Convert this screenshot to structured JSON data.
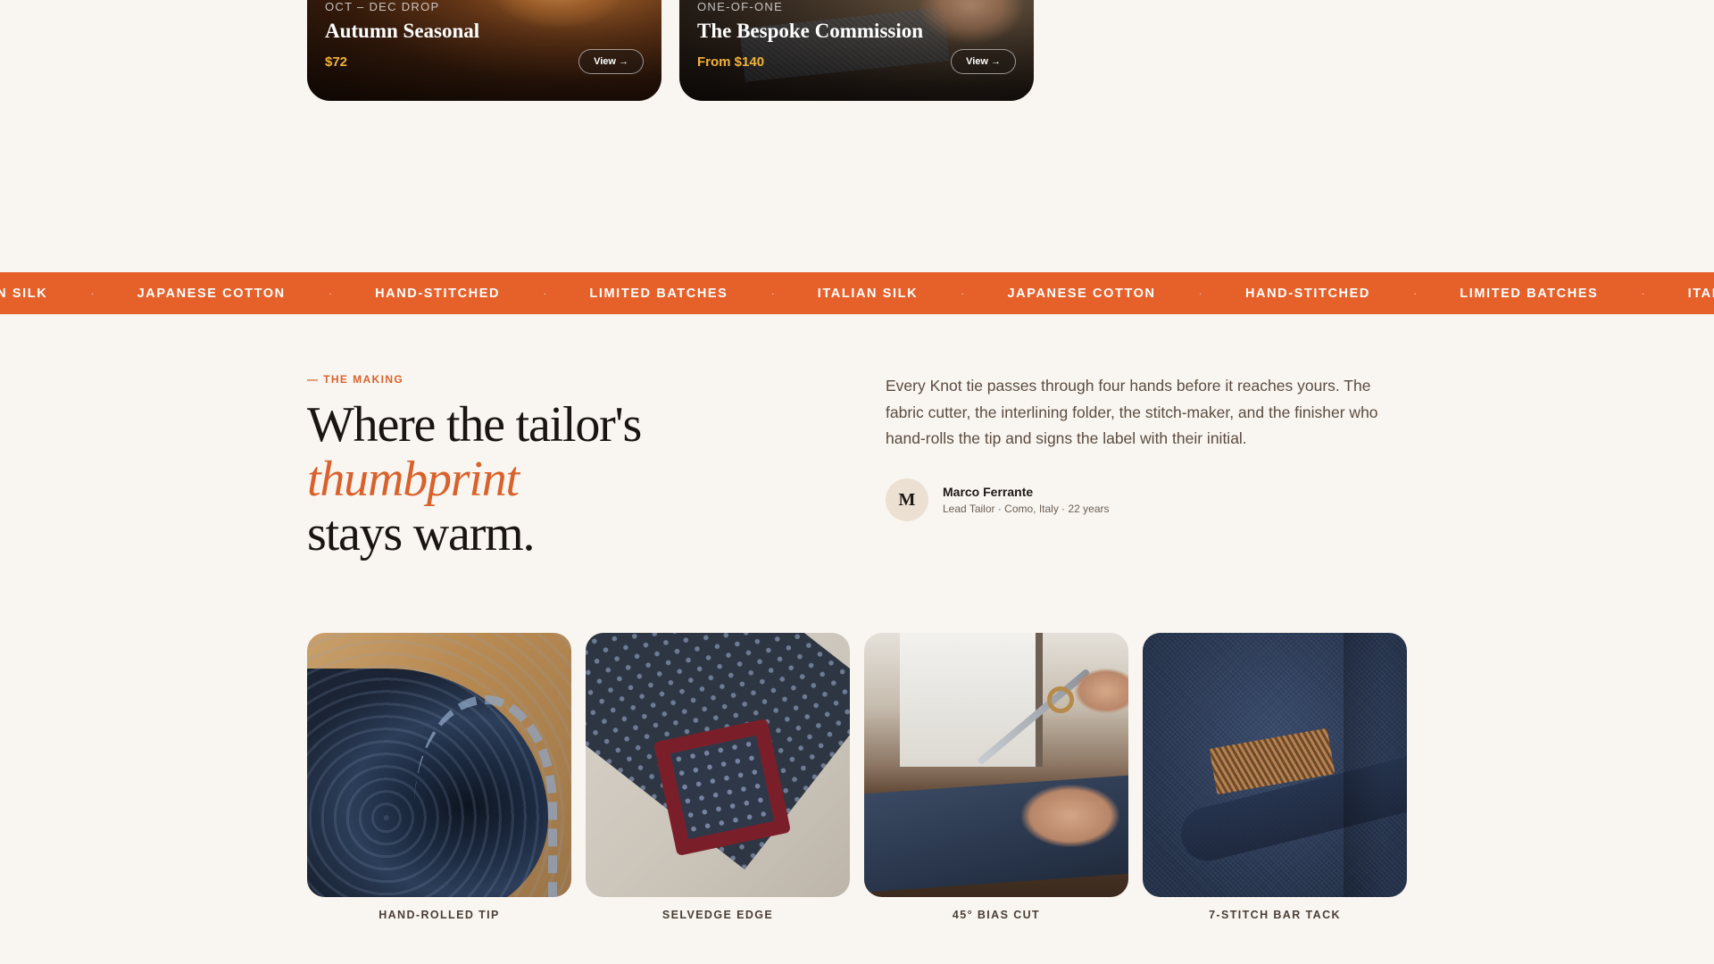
{
  "featured_cards": [
    {
      "eyebrow": "OCT – DEC DROP",
      "title": "Autumn Seasonal",
      "price": "$72",
      "button": "View →"
    },
    {
      "eyebrow": "ONE-OF-ONE",
      "title": "The Bespoke Commission",
      "price": "From $140",
      "button": "View →"
    }
  ],
  "marquee": {
    "items": [
      "LIAN SILK",
      "JAPANESE COTTON",
      "HAND-STITCHED",
      "LIMITED BATCHES",
      "ITALIAN SILK",
      "JAPANESE COTTON",
      "HAND-STITCHED",
      "LIMITED BATCHES",
      "ITALI"
    ],
    "separator": "·",
    "color": "#e6602a"
  },
  "making": {
    "eyebrow": "— THE MAKING",
    "headline_line1": "Where the tailor's",
    "headline_accent": "thumbprint",
    "headline_line3": "stays warm.",
    "body": "Every Knot tie passes through four hands before it reaches yours. The fabric cutter, the interlining folder, the stitch-maker, and the finisher who hand-rolls the tip and signs the label with their initial.",
    "author": {
      "initial": "M",
      "name": "Marco Ferrante",
      "meta": "Lead Tailor · Como, Italy · 22 years"
    }
  },
  "details": [
    {
      "caption": "HAND-ROLLED TIP"
    },
    {
      "caption": "SELVEDGE EDGE"
    },
    {
      "caption": "45° BIAS CUT"
    },
    {
      "caption": "7-STITCH BAR TACK"
    }
  ],
  "colors": {
    "background": "#f9f6f1",
    "accent": "#d9622c",
    "price": "#f3b23a"
  }
}
